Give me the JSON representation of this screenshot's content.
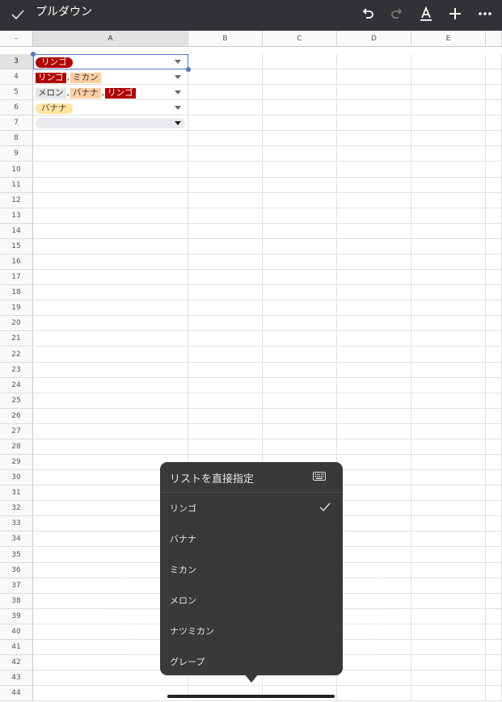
{
  "toolbar": {
    "title": "プルダウン",
    "icons": [
      "check-icon",
      "undo-icon",
      "redo-icon",
      "text-format-icon",
      "plus-icon",
      "more-icon"
    ]
  },
  "columns": [
    "A",
    "B",
    "C",
    "D",
    "E"
  ],
  "selected_column": "A",
  "selected_row": "3",
  "rows": [
    "3",
    "4",
    "5",
    "6",
    "7",
    "8",
    "9",
    "10",
    "11",
    "12",
    "13",
    "14",
    "15",
    "16",
    "17",
    "18",
    "19",
    "20",
    "21",
    "22",
    "23",
    "24",
    "25",
    "26",
    "27",
    "28",
    "29",
    "30",
    "31",
    "32",
    "33",
    "34",
    "35",
    "36",
    "37",
    "38",
    "39",
    "40",
    "41",
    "42",
    "43",
    "44"
  ],
  "cells": [
    {
      "row": "3",
      "chips": [
        {
          "text": "リンゴ",
          "color": "red"
        }
      ]
    },
    {
      "row": "4",
      "chips": [
        {
          "text": "リンゴ",
          "color": "red"
        },
        {
          "text": "ミカン",
          "color": "orange"
        }
      ]
    },
    {
      "row": "5",
      "chips": [
        {
          "text": "メロン",
          "color": "grey"
        },
        {
          "text": "バナナ",
          "color": "orange"
        },
        {
          "text": "リンゴ",
          "color": "red"
        }
      ]
    },
    {
      "row": "6",
      "chips": [
        {
          "text": "バナナ",
          "color": "yellow"
        }
      ]
    },
    {
      "row": "7",
      "chips": []
    }
  ],
  "popup": {
    "title": "リストを直接指定",
    "keyboard_icon": "keyboard-icon",
    "options": [
      {
        "label": "リンゴ",
        "checked": true
      },
      {
        "label": "バナナ",
        "checked": false
      },
      {
        "label": "ミカン",
        "checked": false
      },
      {
        "label": "メロン",
        "checked": false
      },
      {
        "label": "ナツミカン",
        "checked": false
      },
      {
        "label": "グレープ",
        "checked": false
      }
    ]
  },
  "colors": {
    "toolbar_bg": "#323236",
    "popup_bg": "#39393c",
    "selection": "#4f79c9",
    "chip_red": "#b10202",
    "chip_orange": "#ffcfa1",
    "chip_grey": "#e6e6e6",
    "chip_yellow": "#ffe5a0"
  }
}
